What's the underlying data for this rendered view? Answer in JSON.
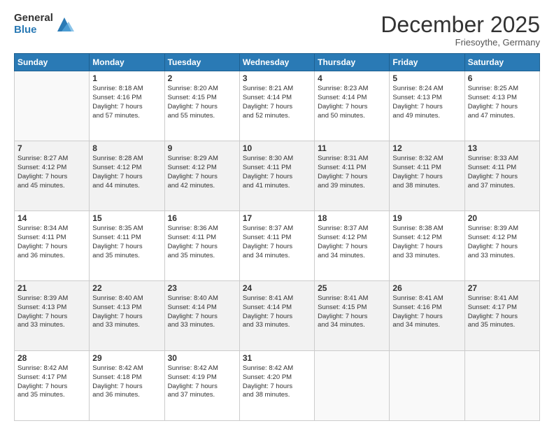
{
  "logo": {
    "general": "General",
    "blue": "Blue"
  },
  "header": {
    "month": "December 2025",
    "location": "Friesoythe, Germany"
  },
  "days": [
    "Sunday",
    "Monday",
    "Tuesday",
    "Wednesday",
    "Thursday",
    "Friday",
    "Saturday"
  ],
  "weeks": [
    [
      {
        "day": "",
        "info": ""
      },
      {
        "day": "1",
        "info": "Sunrise: 8:18 AM\nSunset: 4:16 PM\nDaylight: 7 hours\nand 57 minutes."
      },
      {
        "day": "2",
        "info": "Sunrise: 8:20 AM\nSunset: 4:15 PM\nDaylight: 7 hours\nand 55 minutes."
      },
      {
        "day": "3",
        "info": "Sunrise: 8:21 AM\nSunset: 4:14 PM\nDaylight: 7 hours\nand 52 minutes."
      },
      {
        "day": "4",
        "info": "Sunrise: 8:23 AM\nSunset: 4:14 PM\nDaylight: 7 hours\nand 50 minutes."
      },
      {
        "day": "5",
        "info": "Sunrise: 8:24 AM\nSunset: 4:13 PM\nDaylight: 7 hours\nand 49 minutes."
      },
      {
        "day": "6",
        "info": "Sunrise: 8:25 AM\nSunset: 4:13 PM\nDaylight: 7 hours\nand 47 minutes."
      }
    ],
    [
      {
        "day": "7",
        "info": "Sunrise: 8:27 AM\nSunset: 4:12 PM\nDaylight: 7 hours\nand 45 minutes."
      },
      {
        "day": "8",
        "info": "Sunrise: 8:28 AM\nSunset: 4:12 PM\nDaylight: 7 hours\nand 44 minutes."
      },
      {
        "day": "9",
        "info": "Sunrise: 8:29 AM\nSunset: 4:12 PM\nDaylight: 7 hours\nand 42 minutes."
      },
      {
        "day": "10",
        "info": "Sunrise: 8:30 AM\nSunset: 4:11 PM\nDaylight: 7 hours\nand 41 minutes."
      },
      {
        "day": "11",
        "info": "Sunrise: 8:31 AM\nSunset: 4:11 PM\nDaylight: 7 hours\nand 39 minutes."
      },
      {
        "day": "12",
        "info": "Sunrise: 8:32 AM\nSunset: 4:11 PM\nDaylight: 7 hours\nand 38 minutes."
      },
      {
        "day": "13",
        "info": "Sunrise: 8:33 AM\nSunset: 4:11 PM\nDaylight: 7 hours\nand 37 minutes."
      }
    ],
    [
      {
        "day": "14",
        "info": "Sunrise: 8:34 AM\nSunset: 4:11 PM\nDaylight: 7 hours\nand 36 minutes."
      },
      {
        "day": "15",
        "info": "Sunrise: 8:35 AM\nSunset: 4:11 PM\nDaylight: 7 hours\nand 35 minutes."
      },
      {
        "day": "16",
        "info": "Sunrise: 8:36 AM\nSunset: 4:11 PM\nDaylight: 7 hours\nand 35 minutes."
      },
      {
        "day": "17",
        "info": "Sunrise: 8:37 AM\nSunset: 4:11 PM\nDaylight: 7 hours\nand 34 minutes."
      },
      {
        "day": "18",
        "info": "Sunrise: 8:37 AM\nSunset: 4:12 PM\nDaylight: 7 hours\nand 34 minutes."
      },
      {
        "day": "19",
        "info": "Sunrise: 8:38 AM\nSunset: 4:12 PM\nDaylight: 7 hours\nand 33 minutes."
      },
      {
        "day": "20",
        "info": "Sunrise: 8:39 AM\nSunset: 4:12 PM\nDaylight: 7 hours\nand 33 minutes."
      }
    ],
    [
      {
        "day": "21",
        "info": "Sunrise: 8:39 AM\nSunset: 4:13 PM\nDaylight: 7 hours\nand 33 minutes."
      },
      {
        "day": "22",
        "info": "Sunrise: 8:40 AM\nSunset: 4:13 PM\nDaylight: 7 hours\nand 33 minutes."
      },
      {
        "day": "23",
        "info": "Sunrise: 8:40 AM\nSunset: 4:14 PM\nDaylight: 7 hours\nand 33 minutes."
      },
      {
        "day": "24",
        "info": "Sunrise: 8:41 AM\nSunset: 4:14 PM\nDaylight: 7 hours\nand 33 minutes."
      },
      {
        "day": "25",
        "info": "Sunrise: 8:41 AM\nSunset: 4:15 PM\nDaylight: 7 hours\nand 34 minutes."
      },
      {
        "day": "26",
        "info": "Sunrise: 8:41 AM\nSunset: 4:16 PM\nDaylight: 7 hours\nand 34 minutes."
      },
      {
        "day": "27",
        "info": "Sunrise: 8:41 AM\nSunset: 4:17 PM\nDaylight: 7 hours\nand 35 minutes."
      }
    ],
    [
      {
        "day": "28",
        "info": "Sunrise: 8:42 AM\nSunset: 4:17 PM\nDaylight: 7 hours\nand 35 minutes."
      },
      {
        "day": "29",
        "info": "Sunrise: 8:42 AM\nSunset: 4:18 PM\nDaylight: 7 hours\nand 36 minutes."
      },
      {
        "day": "30",
        "info": "Sunrise: 8:42 AM\nSunset: 4:19 PM\nDaylight: 7 hours\nand 37 minutes."
      },
      {
        "day": "31",
        "info": "Sunrise: 8:42 AM\nSunset: 4:20 PM\nDaylight: 7 hours\nand 38 minutes."
      },
      {
        "day": "",
        "info": ""
      },
      {
        "day": "",
        "info": ""
      },
      {
        "day": "",
        "info": ""
      }
    ]
  ]
}
